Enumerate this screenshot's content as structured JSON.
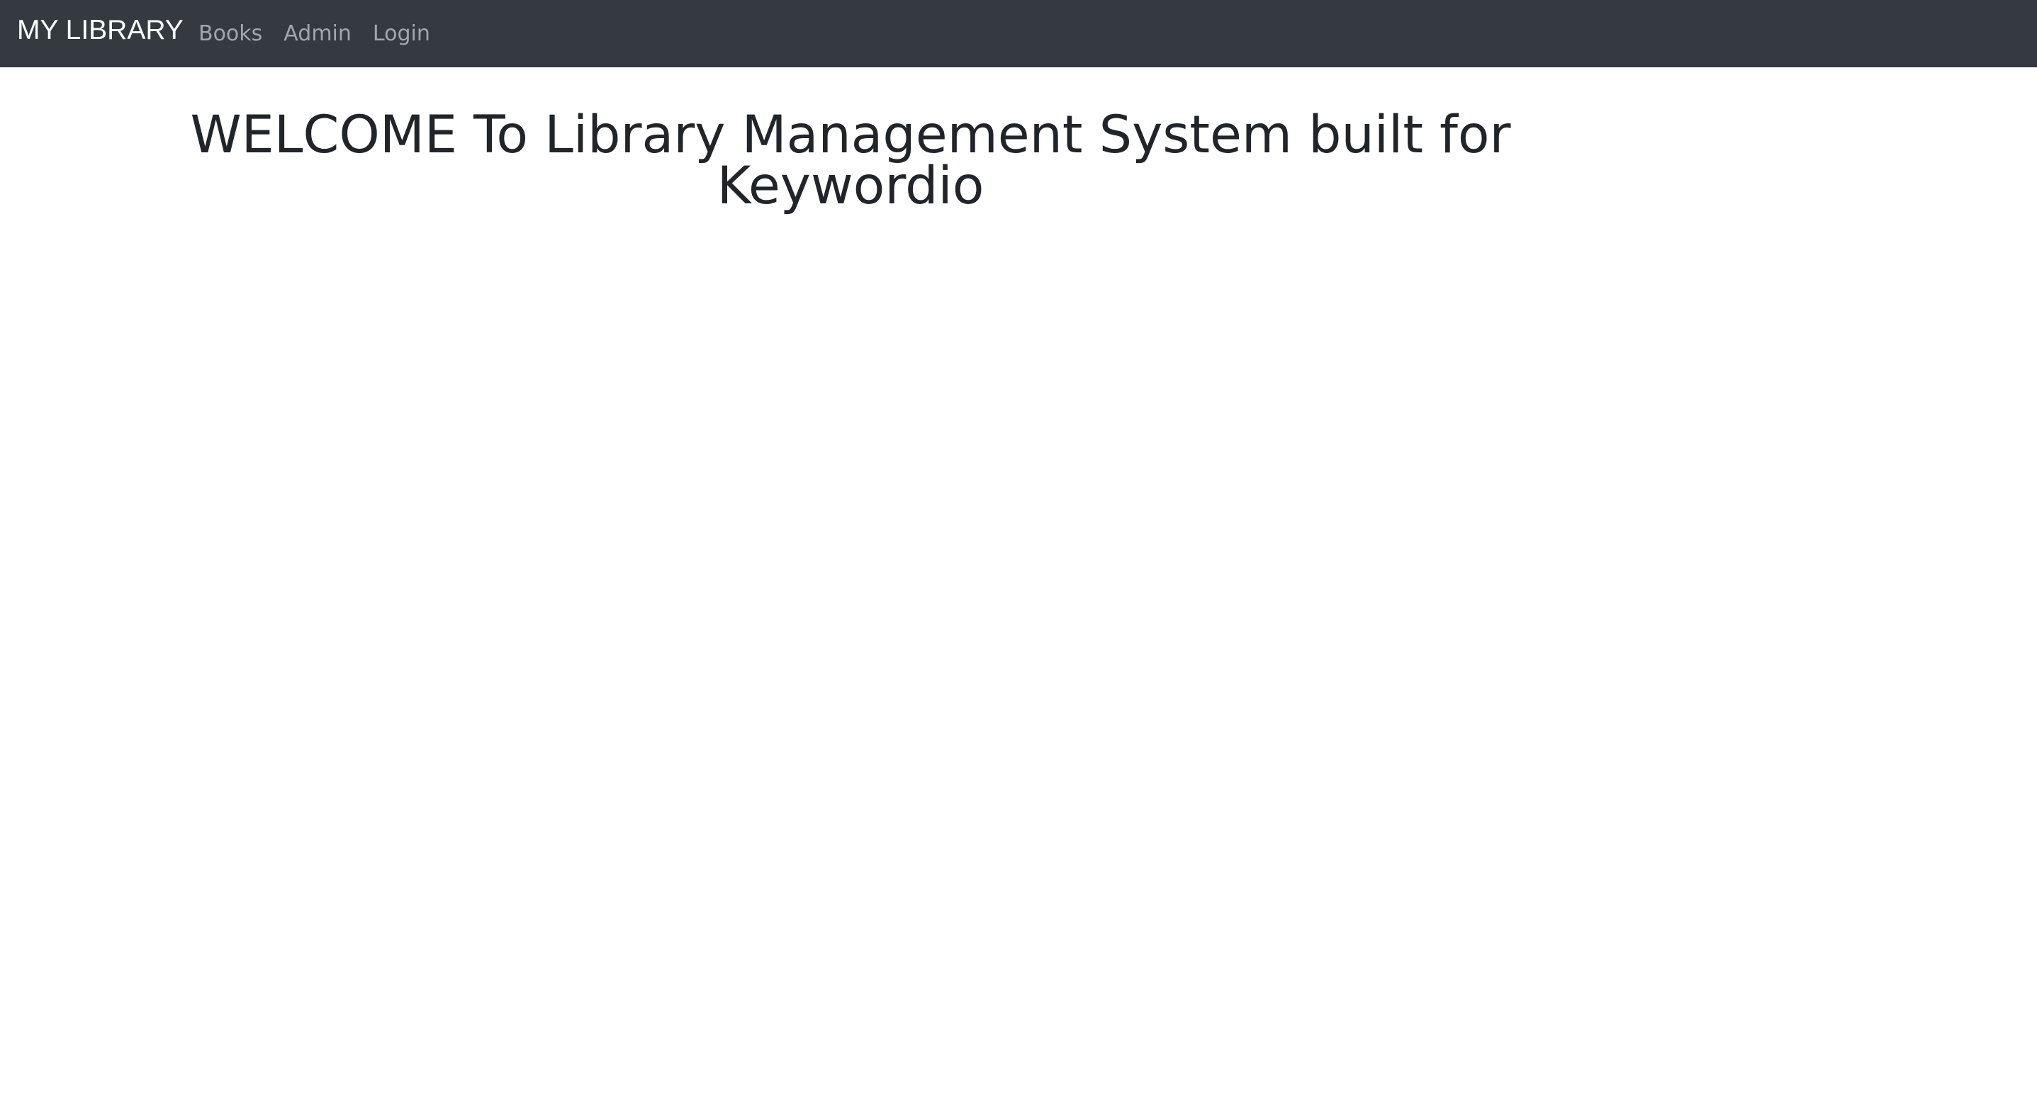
{
  "navbar": {
    "brand": "MY LIBRARY",
    "links": [
      {
        "label": "Books"
      },
      {
        "label": "Admin"
      },
      {
        "label": "Login"
      }
    ],
    "background": "#343a40",
    "link_color": "rgba(255,255,255,0.55)"
  },
  "main": {
    "welcome_line1": "WELCOME To Library Management System built for",
    "welcome_line2": "Keywordio"
  }
}
